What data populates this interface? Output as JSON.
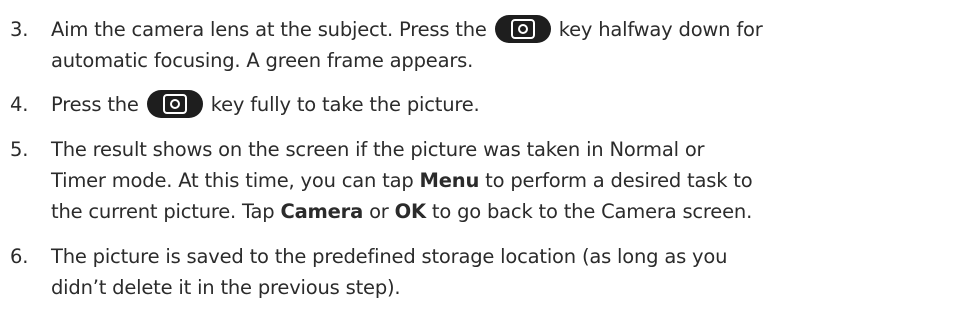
{
  "steps": [
    {
      "number": "3.",
      "line1_before": "Aim the camera lens at the subject. Press the",
      "line1_after": "key halfway down for",
      "line2": "automatic focusing. A green frame appears."
    },
    {
      "number": "4.",
      "before": "Press the",
      "after": "key fully to take the picture."
    },
    {
      "number": "5.",
      "line1": "The result shows on the screen if the picture was taken in Normal or",
      "line2_a": "Timer mode. At this time, you can tap",
      "line2_b": "Menu",
      "line2_c": "to perform a desired task to",
      "line3_a": "the current picture. Tap",
      "line3_b": "Camera",
      "line3_c": "or",
      "line3_d": "OK",
      "line3_e": "to go back to the Camera screen."
    },
    {
      "number": "6.",
      "line1": "The picture is saved to the predefined storage location (as long as you",
      "line2": "didn’t delete it in the previous step)."
    }
  ],
  "icons": {
    "camera_key": "camera-key-icon"
  }
}
